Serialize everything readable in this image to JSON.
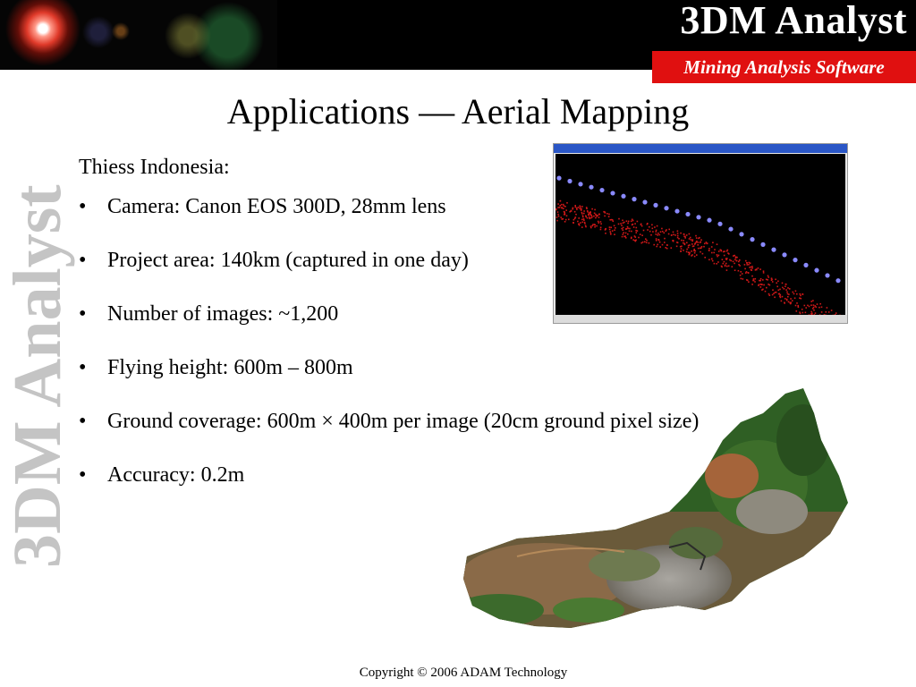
{
  "header": {
    "brand": "3DM Analyst",
    "subtitle": "Mining Analysis Software"
  },
  "side_watermark": "3DM Analyst",
  "slide": {
    "title": "Applications — Aerial Mapping",
    "lead": "Thiess Indonesia:",
    "bullet_symbol": "•",
    "bullets": [
      "Camera: Canon EOS 300D, 28mm lens",
      "Project area: 140km (captured in one day)",
      "Number of images: ~1,200",
      "Flying height: 600m – 800m",
      "Ground coverage: 600m × 400m per image (20cm ground pixel size)",
      "Accuracy: 0.2m"
    ]
  },
  "images": {
    "screenshot": "camera-station-point-cloud-view",
    "orthophoto": "aerial-orthophoto-mine-site"
  },
  "colors": {
    "header_bg": "#000000",
    "subtitle_bg": "#e01010",
    "watermark": "#c4c4c4",
    "camera_points": "#8a8aff",
    "ground_points": "#d01818"
  },
  "footer": {
    "copyright": "Copyright © 2006 ADAM Technology"
  }
}
